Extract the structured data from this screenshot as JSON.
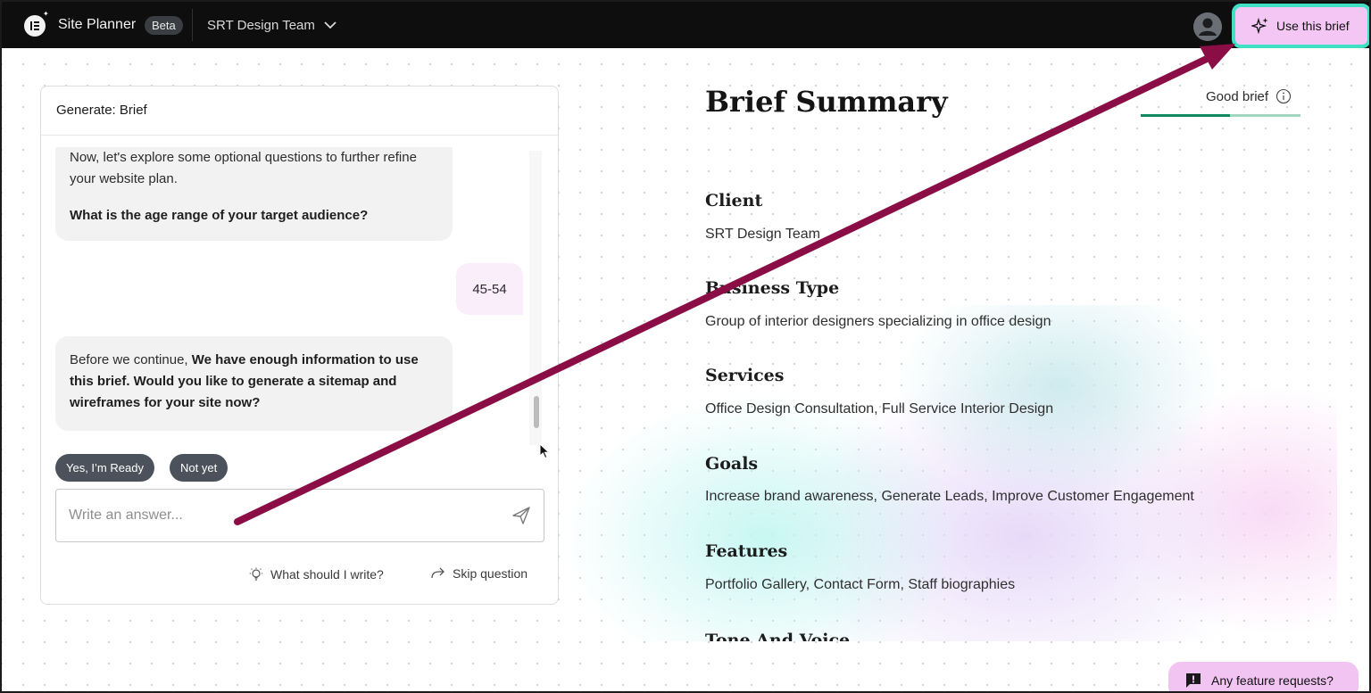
{
  "topbar": {
    "app_title": "Site Planner",
    "beta_badge": "Beta",
    "team_name": "SRT Design Team",
    "use_brief_label": "Use this brief"
  },
  "chat": {
    "header_title": "Generate: Brief",
    "bot_message_1": {
      "line1": "Now, let's explore some optional questions to further refine your website plan.",
      "question": "What is the age range of your target audience?"
    },
    "user_reply": "45-54",
    "bot_message_2": {
      "prefix": "Before we continue, ",
      "bold": "We have enough information to use this brief. Would you like to generate a sitemap and wireframes for your site now?"
    },
    "chips": [
      "Yes, I’m Ready",
      "Not yet"
    ],
    "answer_placeholder": "Write an answer...",
    "helper_what": "What should I write?",
    "helper_skip": "Skip question"
  },
  "summary": {
    "title": "Brief Summary",
    "quality_label": "Good brief",
    "quality_level": 0.56,
    "sections": [
      {
        "title": "Client",
        "text": "SRT Design Team"
      },
      {
        "title": "Business Type",
        "text": "Group of interior designers specializing in office design"
      },
      {
        "title": "Services",
        "text": "Office Design Consultation, Full Service Interior Design"
      },
      {
        "title": "Goals",
        "text": "Increase brand awareness, Generate Leads, Improve Customer Engagement"
      },
      {
        "title": "Features",
        "text": "Portfolio Gallery, Contact Form, Staff biographies"
      },
      {
        "title": "Tone And Voice",
        "text": ""
      }
    ]
  },
  "feature_requests_label": "Any feature requests?",
  "colors": {
    "accent_pink": "#f4c6f4",
    "highlight_teal": "#3fe0c4",
    "annotation_arrow": "#8b0d45",
    "meter_green": "#0f8a5f"
  }
}
